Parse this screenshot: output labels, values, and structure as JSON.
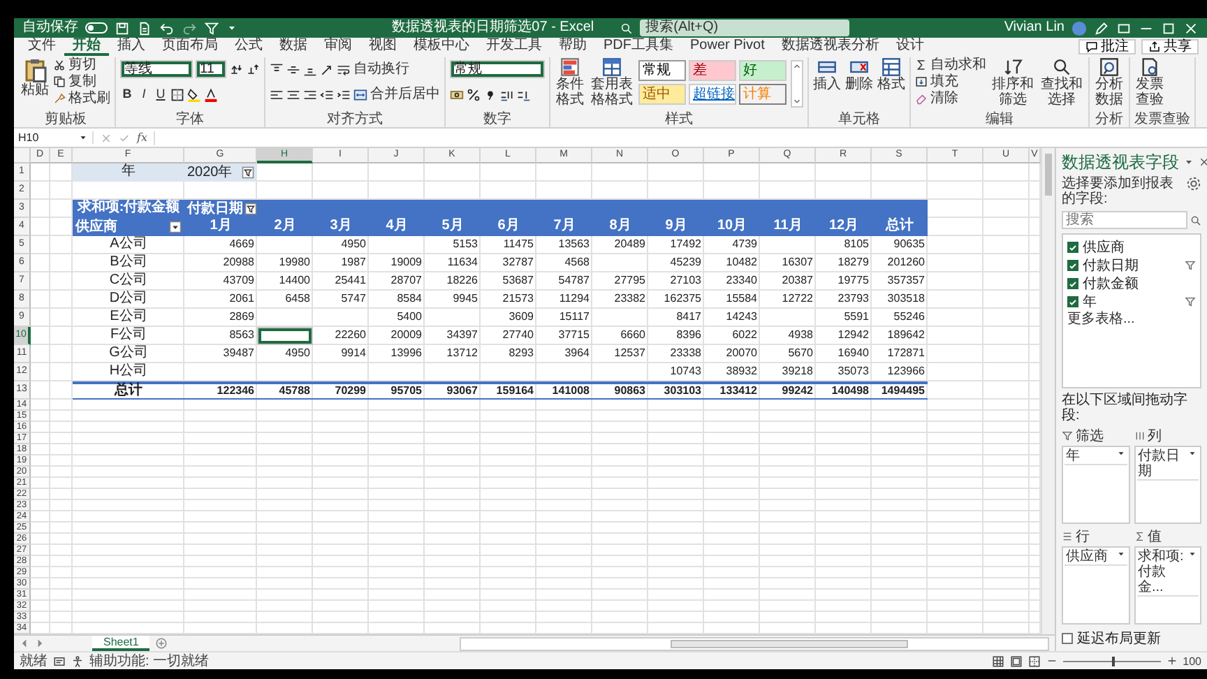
{
  "title_bar": {
    "autosave_label": "自动保存",
    "autosave_on": false,
    "document_title": "数据透视表的日期筛选07 - Excel",
    "search_placeholder": "搜索(Alt+Q)",
    "user_name": "Vivian Lin"
  },
  "menu_tabs": [
    {
      "label": "文件",
      "selected": false
    },
    {
      "label": "开始",
      "selected": true
    },
    {
      "label": "插入",
      "selected": false
    },
    {
      "label": "页面布局",
      "selected": false
    },
    {
      "label": "公式",
      "selected": false
    },
    {
      "label": "数据",
      "selected": false
    },
    {
      "label": "审阅",
      "selected": false
    },
    {
      "label": "视图",
      "selected": false
    },
    {
      "label": "模板中心",
      "selected": false
    },
    {
      "label": "开发工具",
      "selected": false
    },
    {
      "label": "帮助",
      "selected": false
    },
    {
      "label": "PDF工具集",
      "selected": false
    },
    {
      "label": "Power Pivot",
      "selected": false
    },
    {
      "label": "数据透视表分析",
      "selected": false
    },
    {
      "label": "设计",
      "selected": false
    }
  ],
  "menu_actions": [
    "批注",
    "共享"
  ],
  "ribbon": {
    "groups": [
      {
        "kind": "clipboard",
        "title": "剪贴板",
        "items": [
          "粘贴",
          "剪切",
          "复制",
          "格式刷"
        ]
      },
      {
        "kind": "font",
        "title": "字体",
        "font_name": "等线",
        "font_size": "11",
        "format_buttons": [
          "B",
          "I",
          "U"
        ]
      },
      {
        "kind": "alignment",
        "title": "对齐方式",
        "items": [
          "自动换行",
          "合并后居中"
        ]
      },
      {
        "kind": "number",
        "title": "数字",
        "format": "常规"
      },
      {
        "kind": "styles",
        "title": "样式",
        "items": [
          "条件格式",
          "套用表格格式"
        ],
        "gallery": [
          {
            "label": "常规",
            "kind": "normal"
          },
          {
            "label": "差",
            "kind": "bad"
          },
          {
            "label": "好",
            "kind": "good"
          },
          {
            "label": "适中",
            "kind": "neutral"
          },
          {
            "label": "超链接",
            "kind": "link"
          },
          {
            "label": "计算",
            "kind": "calc"
          }
        ]
      },
      {
        "kind": "cells",
        "title": "单元格",
        "items": [
          "插入",
          "删除",
          "格式"
        ]
      },
      {
        "kind": "editing",
        "title": "编辑",
        "items": [
          "自动求和",
          "填充",
          "清除",
          "排序和筛选",
          "查找和选择"
        ]
      },
      {
        "kind": "analysis",
        "title": "分析",
        "items": [
          "分析数据"
        ]
      },
      {
        "kind": "invoice",
        "title": "发票查验",
        "items": [
          "发票查验"
        ]
      }
    ]
  },
  "formula_bar": {
    "cell_ref": "H10",
    "function_label": "fx"
  },
  "sheet": {
    "columns": [
      {
        "label": "D",
        "selected": false
      },
      {
        "label": "E",
        "selected": false
      },
      {
        "label": "F",
        "selected": false
      },
      {
        "label": "G",
        "selected": false
      },
      {
        "label": "H",
        "selected": true
      },
      {
        "label": "I",
        "selected": false
      },
      {
        "label": "J",
        "selected": false
      },
      {
        "label": "K",
        "selected": false
      },
      {
        "label": "L",
        "selected": false
      },
      {
        "label": "M",
        "selected": false
      },
      {
        "label": "N",
        "selected": false
      },
      {
        "label": "O",
        "selected": false
      },
      {
        "label": "P",
        "selected": false
      },
      {
        "label": "Q",
        "selected": false
      },
      {
        "label": "R",
        "selected": false
      },
      {
        "label": "S",
        "selected": false
      },
      {
        "label": "T",
        "selected": false
      },
      {
        "label": "U",
        "selected": false
      },
      {
        "label": "V",
        "selected": false
      }
    ],
    "row_numbers": [
      {
        "label": "1",
        "selected": false
      },
      {
        "label": "2",
        "selected": false
      },
      {
        "label": "3",
        "selected": false
      },
      {
        "label": "4",
        "selected": false
      },
      {
        "label": "5",
        "selected": false
      },
      {
        "label": "6",
        "selected": false
      },
      {
        "label": "7",
        "selected": false
      },
      {
        "label": "8",
        "selected": false
      },
      {
        "label": "9",
        "selected": false
      },
      {
        "label": "10",
        "selected": true
      },
      {
        "label": "11",
        "selected": false
      },
      {
        "label": "12",
        "selected": false
      },
      {
        "label": "13",
        "selected": false
      },
      {
        "label": "14",
        "selected": false
      },
      {
        "label": "15",
        "selected": false
      },
      {
        "label": "16",
        "selected": false
      },
      {
        "label": "17",
        "selected": false
      },
      {
        "label": "18",
        "selected": false
      },
      {
        "label": "19",
        "selected": false
      },
      {
        "label": "20",
        "selected": false
      },
      {
        "label": "21",
        "selected": false
      },
      {
        "label": "22",
        "selected": false
      },
      {
        "label": "23",
        "selected": false
      },
      {
        "label": "24",
        "selected": false
      },
      {
        "label": "25",
        "selected": false
      },
      {
        "label": "26",
        "selected": false
      },
      {
        "label": "27",
        "selected": false
      },
      {
        "label": "28",
        "selected": false
      },
      {
        "label": "29",
        "selected": false
      },
      {
        "label": "30",
        "selected": false
      },
      {
        "label": "31",
        "selected": false
      },
      {
        "label": "32",
        "selected": false
      },
      {
        "label": "33",
        "selected": false
      },
      {
        "label": "34",
        "selected": false
      }
    ]
  },
  "pivot": {
    "filter_field": "年",
    "filter_value": "2020年",
    "value_field": "求和项:付款金额",
    "column_field": "付款日期",
    "row_field": "供应商",
    "column_labels": [
      "1月",
      "2月",
      "3月",
      "4月",
      "5月",
      "6月",
      "7月",
      "8月",
      "9月",
      "10月",
      "11月",
      "12月",
      "总计"
    ],
    "rows": [
      {
        "label": "A公司",
        "cells": [
          {
            "value": "4669"
          },
          {
            "blank": true
          },
          {
            "value": "4950"
          },
          {
            "blank": true
          },
          {
            "value": "5153"
          },
          {
            "value": "11475"
          },
          {
            "value": "13563"
          },
          {
            "value": "20489"
          },
          {
            "value": "17492"
          },
          {
            "value": "4739"
          },
          {
            "blank": true
          },
          {
            "value": "8105"
          },
          {
            "value": "90635"
          }
        ]
      },
      {
        "label": "B公司",
        "cells": [
          {
            "value": "20988"
          },
          {
            "value": "19980"
          },
          {
            "value": "1987"
          },
          {
            "value": "19009"
          },
          {
            "value": "11634"
          },
          {
            "value": "32787"
          },
          {
            "value": "4568"
          },
          {
            "blank": true
          },
          {
            "value": "45239"
          },
          {
            "value": "10482"
          },
          {
            "value": "16307"
          },
          {
            "value": "18279"
          },
          {
            "value": "201260"
          }
        ]
      },
      {
        "label": "C公司",
        "cells": [
          {
            "value": "43709"
          },
          {
            "value": "14400"
          },
          {
            "value": "25441"
          },
          {
            "value": "28707"
          },
          {
            "value": "18226"
          },
          {
            "value": "53687"
          },
          {
            "value": "54787"
          },
          {
            "value": "27795"
          },
          {
            "value": "27103"
          },
          {
            "value": "23340"
          },
          {
            "value": "20387"
          },
          {
            "value": "19775"
          },
          {
            "value": "357357"
          }
        ]
      },
      {
        "label": "D公司",
        "cells": [
          {
            "value": "2061"
          },
          {
            "value": "6458"
          },
          {
            "value": "5747"
          },
          {
            "value": "8584"
          },
          {
            "value": "9945"
          },
          {
            "value": "21573"
          },
          {
            "value": "11294"
          },
          {
            "value": "23382"
          },
          {
            "value": "162375"
          },
          {
            "value": "15584"
          },
          {
            "value": "12722"
          },
          {
            "value": "23793"
          },
          {
            "value": "303518"
          }
        ]
      },
      {
        "label": "E公司",
        "cells": [
          {
            "value": "2869"
          },
          {
            "blank": true
          },
          {
            "blank": true
          },
          {
            "value": "5400"
          },
          {
            "blank": true
          },
          {
            "value": "3609"
          },
          {
            "value": "15117"
          },
          {
            "blank": true
          },
          {
            "value": "8417"
          },
          {
            "value": "14243"
          },
          {
            "blank": true
          },
          {
            "value": "5591"
          },
          {
            "value": "55246"
          }
        ]
      },
      {
        "label": "F公司",
        "cells": [
          {
            "value": "8563"
          },
          {
            "blank": true
          },
          {
            "value": "22260"
          },
          {
            "value": "20009"
          },
          {
            "value": "34397"
          },
          {
            "value": "27740"
          },
          {
            "value": "37715"
          },
          {
            "value": "6660"
          },
          {
            "value": "8396"
          },
          {
            "value": "6022"
          },
          {
            "value": "4938"
          },
          {
            "value": "12942"
          },
          {
            "value": "189642"
          }
        ]
      },
      {
        "label": "G公司",
        "cells": [
          {
            "value": "39487"
          },
          {
            "value": "4950"
          },
          {
            "value": "9914"
          },
          {
            "value": "13996"
          },
          {
            "value": "13712"
          },
          {
            "value": "8293"
          },
          {
            "value": "3964"
          },
          {
            "value": "12537"
          },
          {
            "value": "23338"
          },
          {
            "value": "20070"
          },
          {
            "value": "5670"
          },
          {
            "value": "16940"
          },
          {
            "value": "172871"
          }
        ]
      },
      {
        "label": "H公司",
        "cells": [
          {
            "blank": true
          },
          {
            "blank": true
          },
          {
            "blank": true
          },
          {
            "blank": true
          },
          {
            "blank": true
          },
          {
            "blank": true
          },
          {
            "blank": true
          },
          {
            "blank": true
          },
          {
            "value": "10743"
          },
          {
            "value": "38932"
          },
          {
            "value": "39218"
          },
          {
            "value": "35073"
          },
          {
            "value": "123966"
          }
        ]
      }
    ],
    "total": {
      "label": "总计",
      "values": [
        "122346",
        "45788",
        "70299",
        "95705",
        "93067",
        "159164",
        "141008",
        "90863",
        "303103",
        "133412",
        "99242",
        "140498",
        "1494495"
      ]
    }
  },
  "sheet_tabs": [
    {
      "label": "Sheet1",
      "selected": true
    }
  ],
  "status_bar": {
    "ready": "就绪",
    "accessibility": "辅助功能: 一切就绪",
    "zoom": "100",
    "zoom_slider": {
      "level": 0.5
    }
  },
  "pane": {
    "title": "数据透视表字段",
    "subtitle": "选择要添加到报表的字段:",
    "search_placeholder": "搜索",
    "fields": [
      {
        "label": "供应商",
        "checked": true,
        "filtered": false
      },
      {
        "label": "付款日期",
        "checked": true,
        "filtered": true
      },
      {
        "label": "付款金额",
        "checked": true,
        "filtered": false
      },
      {
        "label": "年",
        "checked": true,
        "filtered": true
      }
    ],
    "more_tables": "更多表格...",
    "drag_hint": "在以下区域间拖动字段:",
    "areas": [
      {
        "kind": "filter",
        "title": "筛选",
        "items": [
          "年"
        ]
      },
      {
        "kind": "columns",
        "title": "列",
        "items": [
          "付款日期"
        ]
      },
      {
        "kind": "rows",
        "title": "行",
        "items": [
          "供应商"
        ]
      },
      {
        "kind": "values",
        "title": "值",
        "items": [
          "求和项:付款金..."
        ]
      }
    ],
    "defer_update": {
      "label": "延迟布局更新",
      "checked": false
    }
  }
}
